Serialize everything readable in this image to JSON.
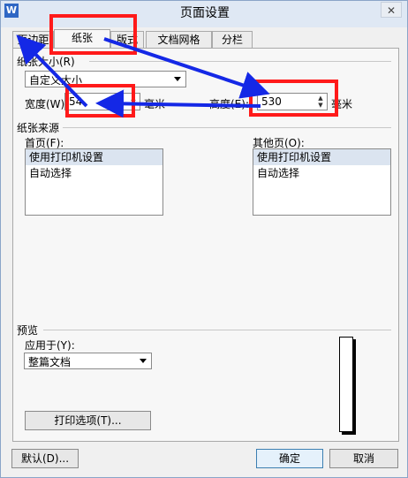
{
  "window": {
    "title": "页面设置",
    "app_icon": "W",
    "close_glyph": "✕"
  },
  "tabs": [
    {
      "label": "页边距"
    },
    {
      "label": "纸张"
    },
    {
      "label": "版式"
    },
    {
      "label": "文档网格"
    },
    {
      "label": "分栏"
    }
  ],
  "paper_size": {
    "label": "纸张大小(R)",
    "selected": "自定义大小",
    "width_label": "宽度(W):",
    "width_value": "54",
    "height_label": "高度(E):",
    "height_value": "530",
    "unit": "毫米"
  },
  "paper_source": {
    "label": "纸张来源",
    "first_page_label": "首页(F):",
    "other_pages_label": "其他页(O):",
    "first_page_items": [
      "使用打印机设置",
      "自动选择"
    ],
    "other_pages_items": [
      "使用打印机设置",
      "自动选择"
    ]
  },
  "preview": {
    "label": "预览",
    "apply_to_label": "应用于(Y):",
    "apply_to_value": "整篇文档",
    "print_options_button": "打印选项(T)..."
  },
  "footer": {
    "default_button": "默认(D)...",
    "ok_button": "确定",
    "cancel_button": "取消"
  },
  "annotation": {
    "highlight_color": "#ff1a1a",
    "arrow_color": "#1428e6"
  }
}
